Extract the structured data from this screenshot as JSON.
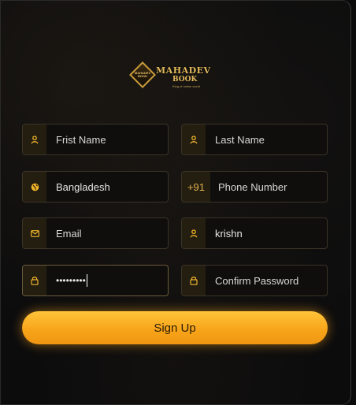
{
  "brand": {
    "name": "MAHADEV",
    "name_line2": "BOOK",
    "tagline": "King of online world",
    "badge_text": "MAHADEV BOOK",
    "accent_color": "#f0b429"
  },
  "form": {
    "first_name": {
      "placeholder": "Frist Name",
      "icon": "user-icon"
    },
    "last_name": {
      "placeholder": "Last Name",
      "icon": "user-icon"
    },
    "country": {
      "value": "Bangladesh",
      "icon": "globe-icon"
    },
    "phone": {
      "prefix": "+91",
      "placeholder": "Phone Number"
    },
    "email": {
      "placeholder": "Email",
      "icon": "mail-icon"
    },
    "username": {
      "value": "krishn",
      "icon": "user-icon"
    },
    "password": {
      "value": "•••••••••",
      "icon": "lock-icon"
    },
    "confirm_password": {
      "placeholder": "Confirm Password",
      "icon": "lock-icon"
    }
  },
  "actions": {
    "signup_label": "Sign Up",
    "signup_color": "#f7a318"
  }
}
